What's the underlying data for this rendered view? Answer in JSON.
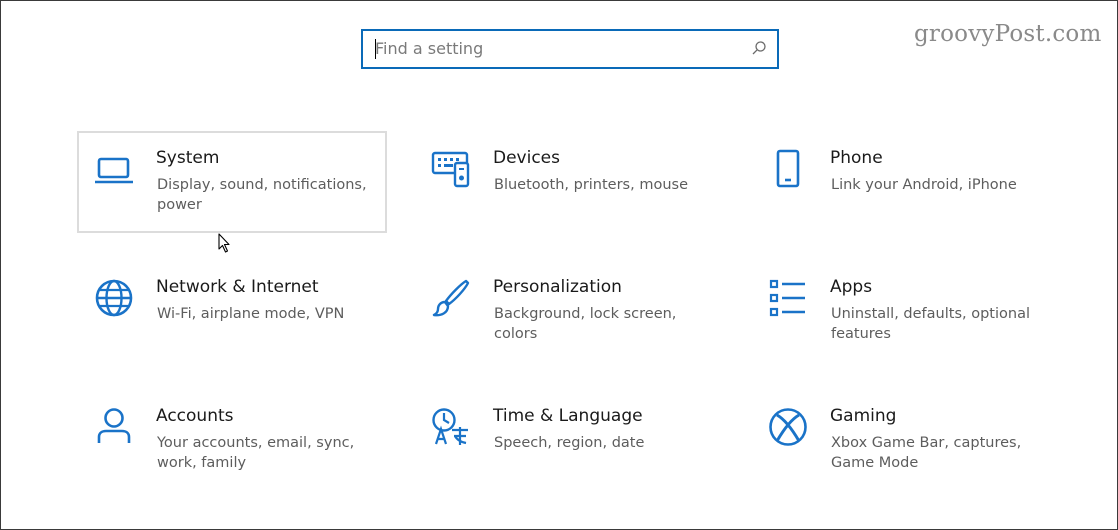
{
  "search": {
    "placeholder": "Find a setting"
  },
  "watermark": "groovyPost.com",
  "colors": {
    "accent": "#0a6ab8",
    "icon": "#1a73c8"
  },
  "tiles": [
    {
      "title": "System",
      "description": "Display, sound, notifications, power",
      "icon": "laptop-icon"
    },
    {
      "title": "Devices",
      "description": "Bluetooth, printers, mouse",
      "icon": "keyboard-devices-icon"
    },
    {
      "title": "Phone",
      "description": "Link your Android, iPhone",
      "icon": "phone-icon"
    },
    {
      "title": "Network & Internet",
      "description": "Wi-Fi, airplane mode, VPN",
      "icon": "globe-icon"
    },
    {
      "title": "Personalization",
      "description": "Background, lock screen, colors",
      "icon": "paintbrush-icon"
    },
    {
      "title": "Apps",
      "description": "Uninstall, defaults, optional features",
      "icon": "apps-list-icon"
    },
    {
      "title": "Accounts",
      "description": "Your accounts, email, sync, work, family",
      "icon": "person-icon"
    },
    {
      "title": "Time & Language",
      "description": "Speech, region, date",
      "icon": "time-language-icon"
    },
    {
      "title": "Gaming",
      "description": "Xbox Game Bar, captures, Game Mode",
      "icon": "xbox-icon"
    }
  ]
}
